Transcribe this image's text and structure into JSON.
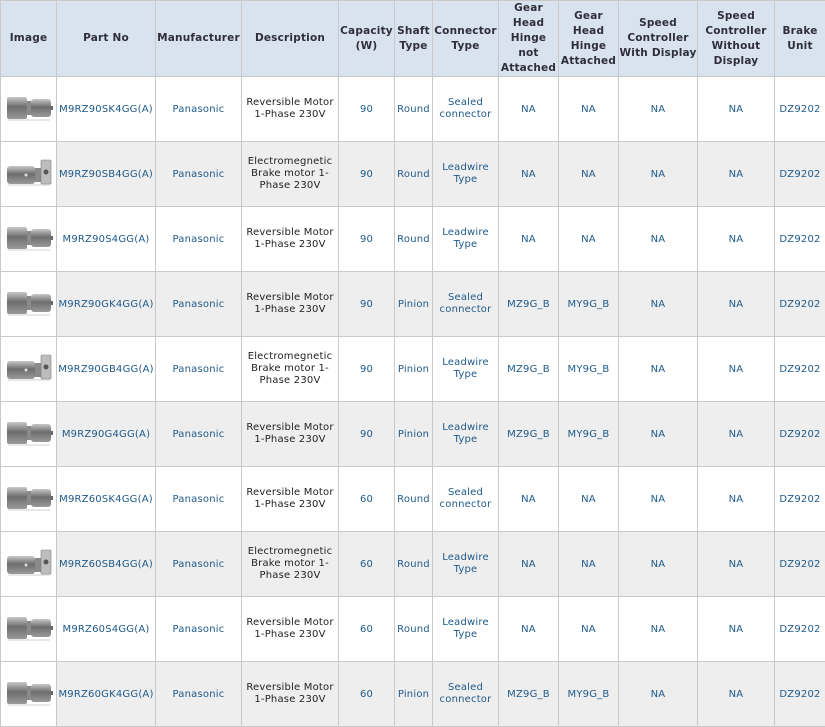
{
  "headers": [
    "Image",
    "Part No",
    "Manufacturer",
    "Description",
    "Capacity\n(W)",
    "Shaft\nType",
    "Connector\nType",
    "Gear\nHead\nHinge not\nAttached",
    "Gear\nHead\nHinge\nAttached",
    "Speed\nController\nWith Display",
    "Speed\nController\nWithout\nDisplay",
    "Brake\nUnit"
  ],
  "rows": [
    {
      "image_icon": "geared-motor-icon",
      "part_no": "M9RZ90SK4GG(A)",
      "manufacturer": "Panasonic",
      "description": "Reversible Motor 1-Phase 230V",
      "capacity": "90",
      "shaft": "Round",
      "connector": "Sealed connector",
      "gh_not": "NA",
      "gh_att": "NA",
      "sc_disp": "NA",
      "sc_nodisp": "NA",
      "brake": "DZ9202"
    },
    {
      "image_icon": "brake-motor-icon",
      "part_no": "M9RZ90SB4GG(A)",
      "manufacturer": "Panasonic",
      "description": "Electromegnetic Brake motor 1-Phase 230V",
      "capacity": "90",
      "shaft": "Round",
      "connector": "Leadwire Type",
      "gh_not": "NA",
      "gh_att": "NA",
      "sc_disp": "NA",
      "sc_nodisp": "NA",
      "brake": "DZ9202"
    },
    {
      "image_icon": "geared-motor-icon",
      "part_no": "M9RZ90S4GG(A)",
      "manufacturer": "Panasonic",
      "description": "Reversible Motor 1-Phase 230V",
      "capacity": "90",
      "shaft": "Round",
      "connector": "Leadwire Type",
      "gh_not": "NA",
      "gh_att": "NA",
      "sc_disp": "NA",
      "sc_nodisp": "NA",
      "brake": "DZ9202"
    },
    {
      "image_icon": "geared-motor-icon",
      "part_no": "M9RZ90GK4GG(A)",
      "manufacturer": "Panasonic",
      "description": "Reversible Motor 1-Phase 230V",
      "capacity": "90",
      "shaft": "Pinion",
      "connector": "Sealed connector",
      "gh_not": "MZ9G_B",
      "gh_att": "MY9G_B",
      "sc_disp": "NA",
      "sc_nodisp": "NA",
      "brake": "DZ9202"
    },
    {
      "image_icon": "brake-motor-icon",
      "part_no": "M9RZ90GB4GG(A)",
      "manufacturer": "Panasonic",
      "description": "Electromegnetic Brake motor 1-Phase 230V",
      "capacity": "90",
      "shaft": "Pinion",
      "connector": "Leadwire Type",
      "gh_not": "MZ9G_B",
      "gh_att": "MY9G_B",
      "sc_disp": "NA",
      "sc_nodisp": "NA",
      "brake": "DZ9202"
    },
    {
      "image_icon": "geared-motor-icon",
      "part_no": "M9RZ90G4GG(A)",
      "manufacturer": "Panasonic",
      "description": "Reversible Motor 1-Phase 230V",
      "capacity": "90",
      "shaft": "Pinion",
      "connector": "Leadwire Type",
      "gh_not": "MZ9G_B",
      "gh_att": "MY9G_B",
      "sc_disp": "NA",
      "sc_nodisp": "NA",
      "brake": "DZ9202"
    },
    {
      "image_icon": "geared-motor-icon",
      "part_no": "M9RZ60SK4GG(A)",
      "manufacturer": "Panasonic",
      "description": "Reversible Motor 1-Phase 230V",
      "capacity": "60",
      "shaft": "Round",
      "connector": "Sealed connector",
      "gh_not": "NA",
      "gh_att": "NA",
      "sc_disp": "NA",
      "sc_nodisp": "NA",
      "brake": "DZ9202"
    },
    {
      "image_icon": "brake-motor-icon",
      "part_no": "M9RZ60SB4GG(A)",
      "manufacturer": "Panasonic",
      "description": "Electromegnetic Brake motor 1-Phase 230V",
      "capacity": "60",
      "shaft": "Round",
      "connector": "Leadwire Type",
      "gh_not": "NA",
      "gh_att": "NA",
      "sc_disp": "NA",
      "sc_nodisp": "NA",
      "brake": "DZ9202"
    },
    {
      "image_icon": "geared-motor-icon",
      "part_no": "M9RZ60S4GG(A)",
      "manufacturer": "Panasonic",
      "description": "Reversible Motor 1-Phase 230V",
      "capacity": "60",
      "shaft": "Round",
      "connector": "Leadwire Type",
      "gh_not": "NA",
      "gh_att": "NA",
      "sc_disp": "NA",
      "sc_nodisp": "NA",
      "brake": "DZ9202"
    },
    {
      "image_icon": "geared-motor-icon",
      "part_no": "M9RZ60GK4GG(A)",
      "manufacturer": "Panasonic",
      "description": "Reversible Motor 1-Phase 230V",
      "capacity": "60",
      "shaft": "Pinion",
      "connector": "Sealed connector",
      "gh_not": "MZ9G_B",
      "gh_att": "MY9G_B",
      "sc_disp": "NA",
      "sc_nodisp": "NA",
      "brake": "DZ9202"
    }
  ],
  "colors": {
    "header_bg": "#d9e2ef",
    "link_text": "#1f5a8a",
    "row_alt_bg": "#eeeeee",
    "border": "#c9c9c9"
  }
}
